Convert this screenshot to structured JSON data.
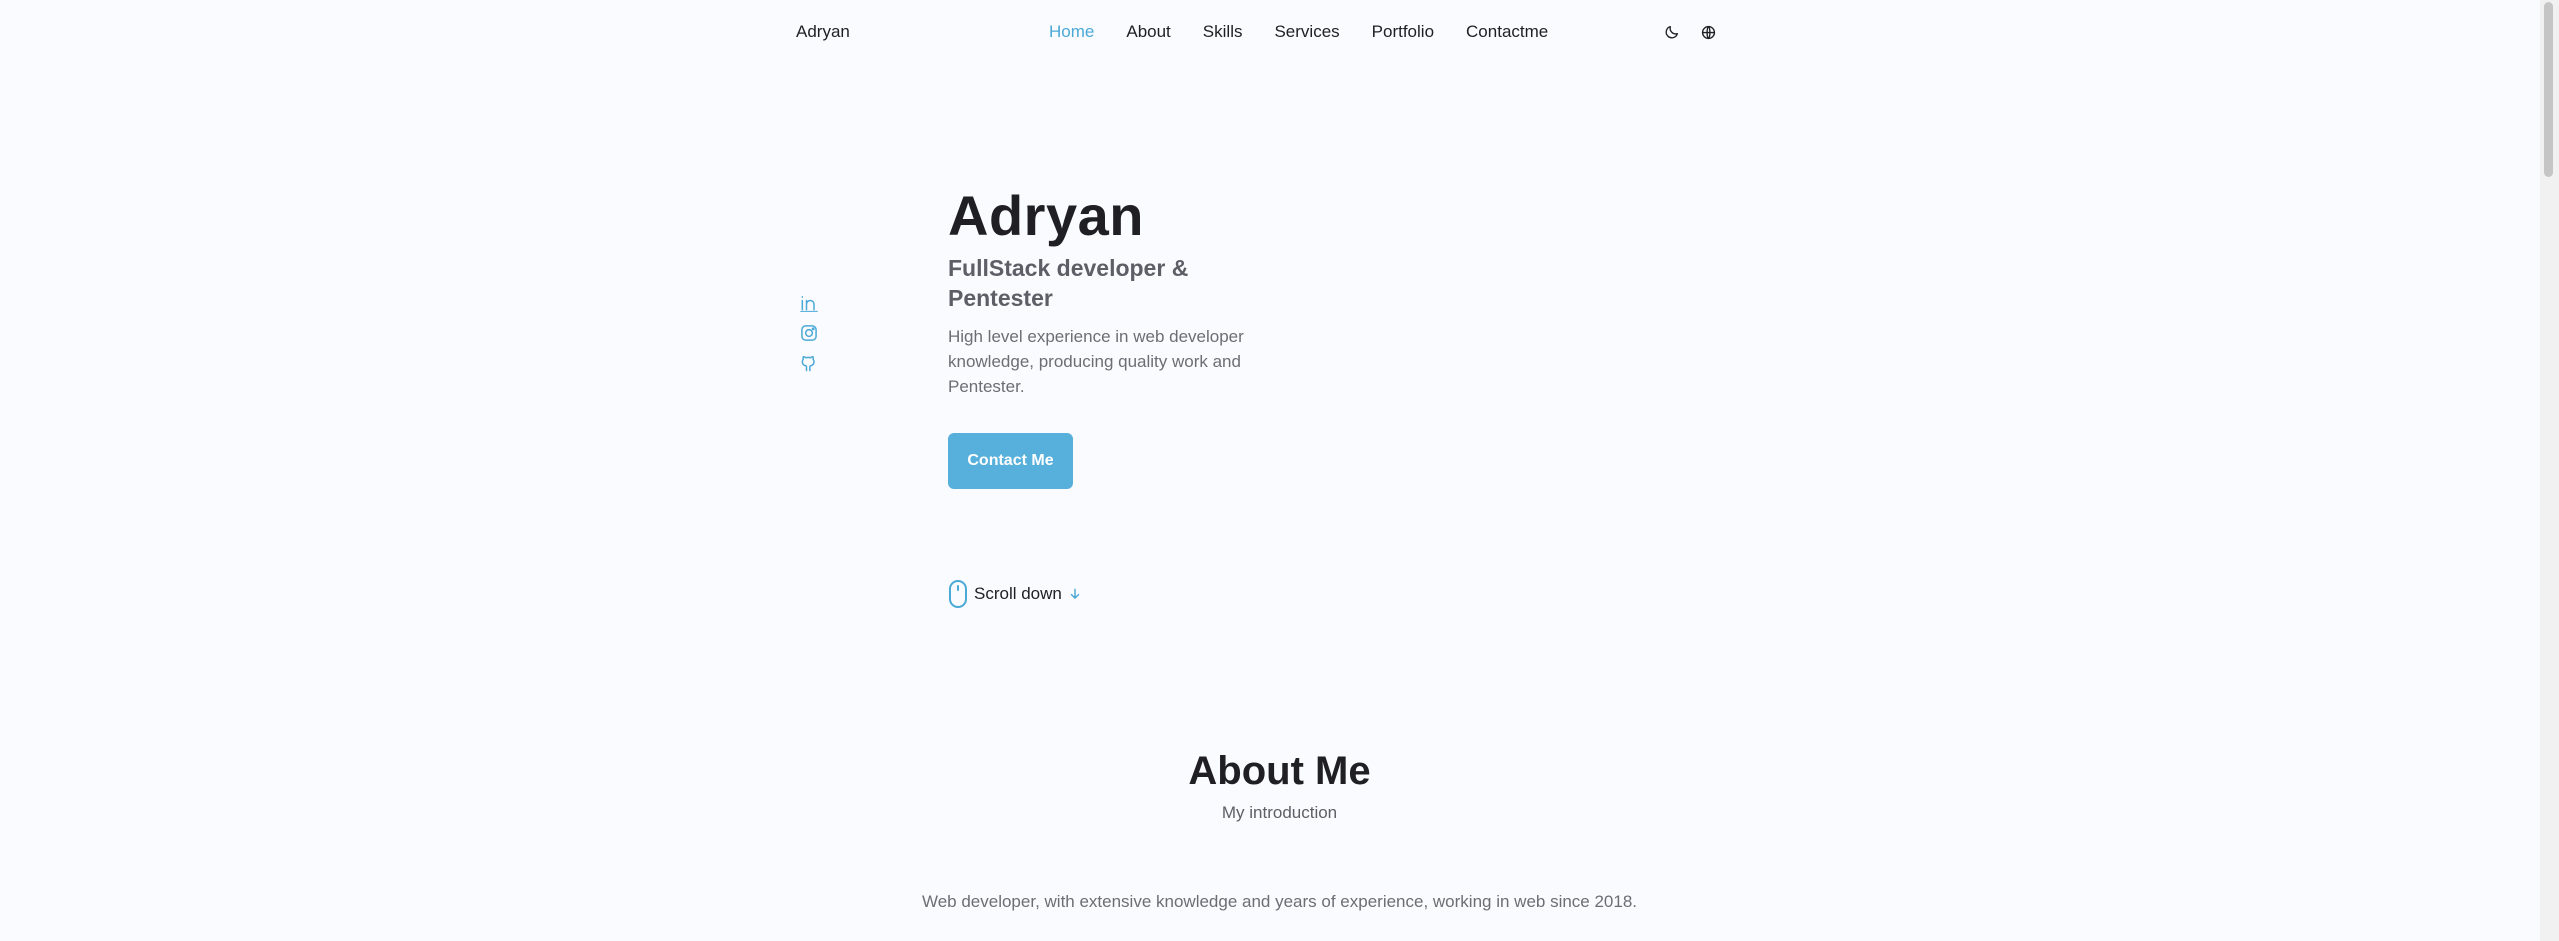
{
  "header": {
    "logo": "Adryan",
    "nav": [
      {
        "label": "Home",
        "active": true
      },
      {
        "label": "About"
      },
      {
        "label": "Skills"
      },
      {
        "label": "Services"
      },
      {
        "label": "Portfolio"
      },
      {
        "label": "Contactme"
      }
    ],
    "icons": [
      "moon-icon",
      "globe-icon"
    ]
  },
  "social": [
    "linkedin-icon",
    "instagram-icon",
    "github-icon"
  ],
  "hero": {
    "title": "Adryan",
    "subtitle": "FullStack developer & Pentester",
    "description": "High level experience in web developer knowledge, producing quality work and Pentester.",
    "button": "Contact Me",
    "scroll": "Scroll down"
  },
  "about": {
    "title": "About Me",
    "subtitle": "My introduction",
    "text": "Web developer, with extensive knowledge and years of experience, working in web since 2018."
  },
  "colors": {
    "accent": "#57b0dc",
    "active_link": "#4aa9d6",
    "background": "#fafbfe",
    "text": "#1f1f24"
  }
}
